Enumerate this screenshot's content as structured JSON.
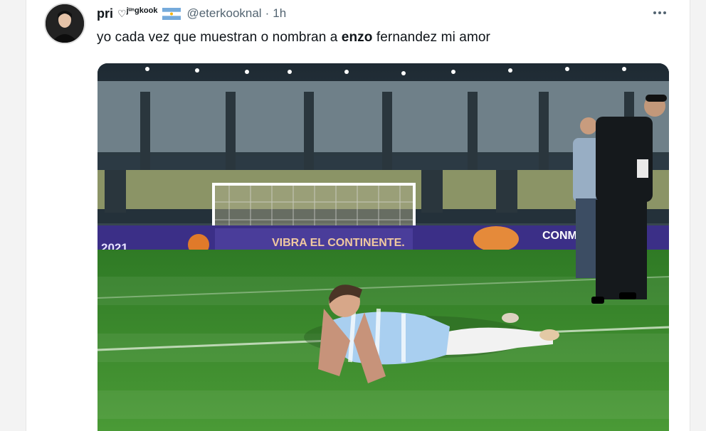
{
  "tweet": {
    "display_name": "pri",
    "name_heart": "♡",
    "name_suffix": "jᵘⁿgkook",
    "flag": "argentina-flag",
    "handle": "@eterkooknal",
    "separator": "·",
    "time": "1h",
    "text_before": "yo cada vez que muestran o nombran a ",
    "text_bold": "enzo",
    "text_after": " fernandez mi amor"
  },
  "image": {
    "banner_year": "2021",
    "banner_slogan": "VIBRA EL CONTINENTE.",
    "banner_right": "CONM"
  },
  "colors": {
    "text_primary": "#0f1419",
    "text_secondary": "#536471",
    "pitch_green": "#3e8a2e",
    "banner_purple": "#3b2f87"
  }
}
